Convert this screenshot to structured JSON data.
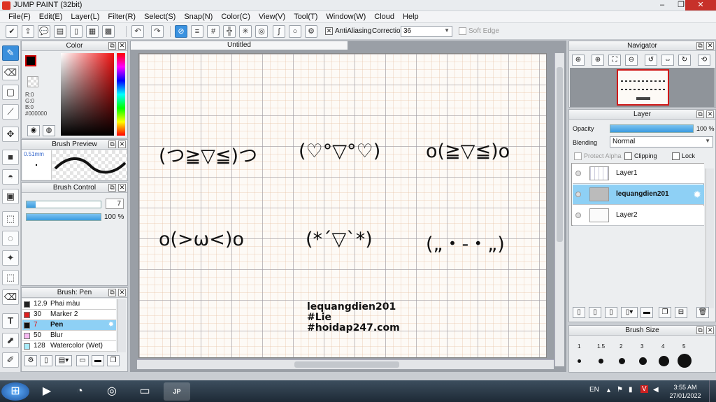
{
  "window": {
    "title": "JUMP PAINT (32bit)"
  },
  "menu": [
    "File(F)",
    "Edit(E)",
    "Layer(L)",
    "Filter(R)",
    "Select(S)",
    "Snap(N)",
    "Color(C)",
    "View(V)",
    "Tool(T)",
    "Window(W)",
    "Cloud",
    "Help"
  ],
  "toolbar": {
    "antialiasing_label": "AntiAliasing",
    "correction_label": "Correction",
    "correction_value": "36",
    "soft_edge_label": "Soft Edge"
  },
  "color_panel": {
    "title": "Color",
    "r": "R:0",
    "g": "G:0",
    "b": "B:0",
    "hex": "#000000",
    "current_color": "#000000"
  },
  "brush_preview": {
    "title": "Brush Preview",
    "size": "0.51mm"
  },
  "brush_control": {
    "title": "Brush Control",
    "size_value": "7",
    "opacity_value": "100 %",
    "opacity_fraction": 1.0
  },
  "brush_list": {
    "title": "Brush: Pen",
    "items": [
      {
        "size": "12.9",
        "name": "Phai màu",
        "color": "#222222"
      },
      {
        "size": "30",
        "name": "Marker 2",
        "color": "#e02020"
      },
      {
        "size": "7",
        "name": "Pen",
        "color": "#111111"
      },
      {
        "size": "50",
        "name": "Blur",
        "color": "#f7b8f2"
      },
      {
        "size": "128",
        "name": "Watercolor (Wet)",
        "color": "#a8ecfb"
      }
    ]
  },
  "document": {
    "tab": "Untitled"
  },
  "canvas": {
    "kaomoji": [
      "(つ≧▽≦)つ",
      "(♡°▽°♡)",
      "o(≧▽≦)o",
      "o(>ω<)o",
      "(*´▽`*)",
      "(„・-・„)"
    ],
    "credit": [
      "lequangdien201",
      "#Lie",
      "#hoidap247.com"
    ]
  },
  "navigator": {
    "title": "Navigator"
  },
  "layer_panel": {
    "title": "Layer",
    "opacity_label": "Opacity",
    "opacity_value": "100 %",
    "opacity_fraction": 1.0,
    "blending_label": "Blending",
    "blending_value": "Normal",
    "protect_alpha": "Protect Alpha",
    "clipping": "Clipping",
    "lock": "Lock",
    "layers": [
      "Layer1",
      "lequangdien201",
      "Layer2"
    ]
  },
  "brush_size": {
    "title": "Brush Size",
    "sizes": [
      "1",
      "1.5",
      "2",
      "3",
      "4",
      "5"
    ]
  },
  "taskbar": {
    "lang": "EN",
    "time": "3:55 AM",
    "date": "27/01/2022"
  }
}
